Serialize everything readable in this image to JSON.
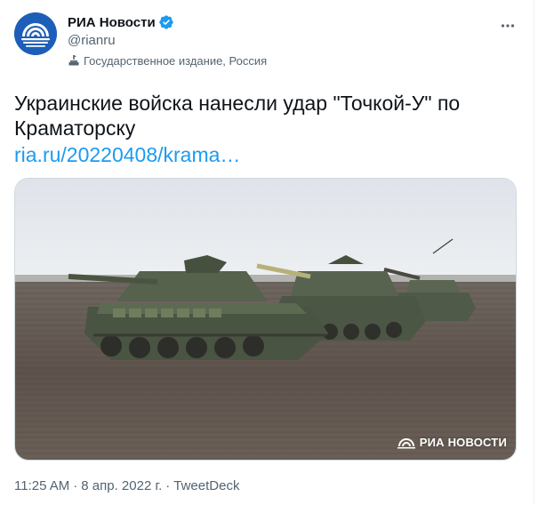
{
  "author": {
    "display_name": "РИА Новости",
    "handle": "@rianru",
    "label": "Государственное издание, Россия",
    "avatar_icon": "ria-logo-icon",
    "verified_icon": "verified-badge-icon"
  },
  "tweet": {
    "text": "Украинские войска нанесли удар \"Точкой-У\" по Краматорску",
    "link": "ria.ru/20220408/krama…",
    "media_watermark": "РИА НОВОСТИ",
    "time": "11:25 AM",
    "separator": "·",
    "date": "8 апр. 2022 г.",
    "source": "TweetDeck"
  },
  "colors": {
    "link": "#1d9bf0",
    "verified": "#1d9bf0",
    "text_secondary": "#536471",
    "avatar_bg": "#1d5fb8"
  }
}
